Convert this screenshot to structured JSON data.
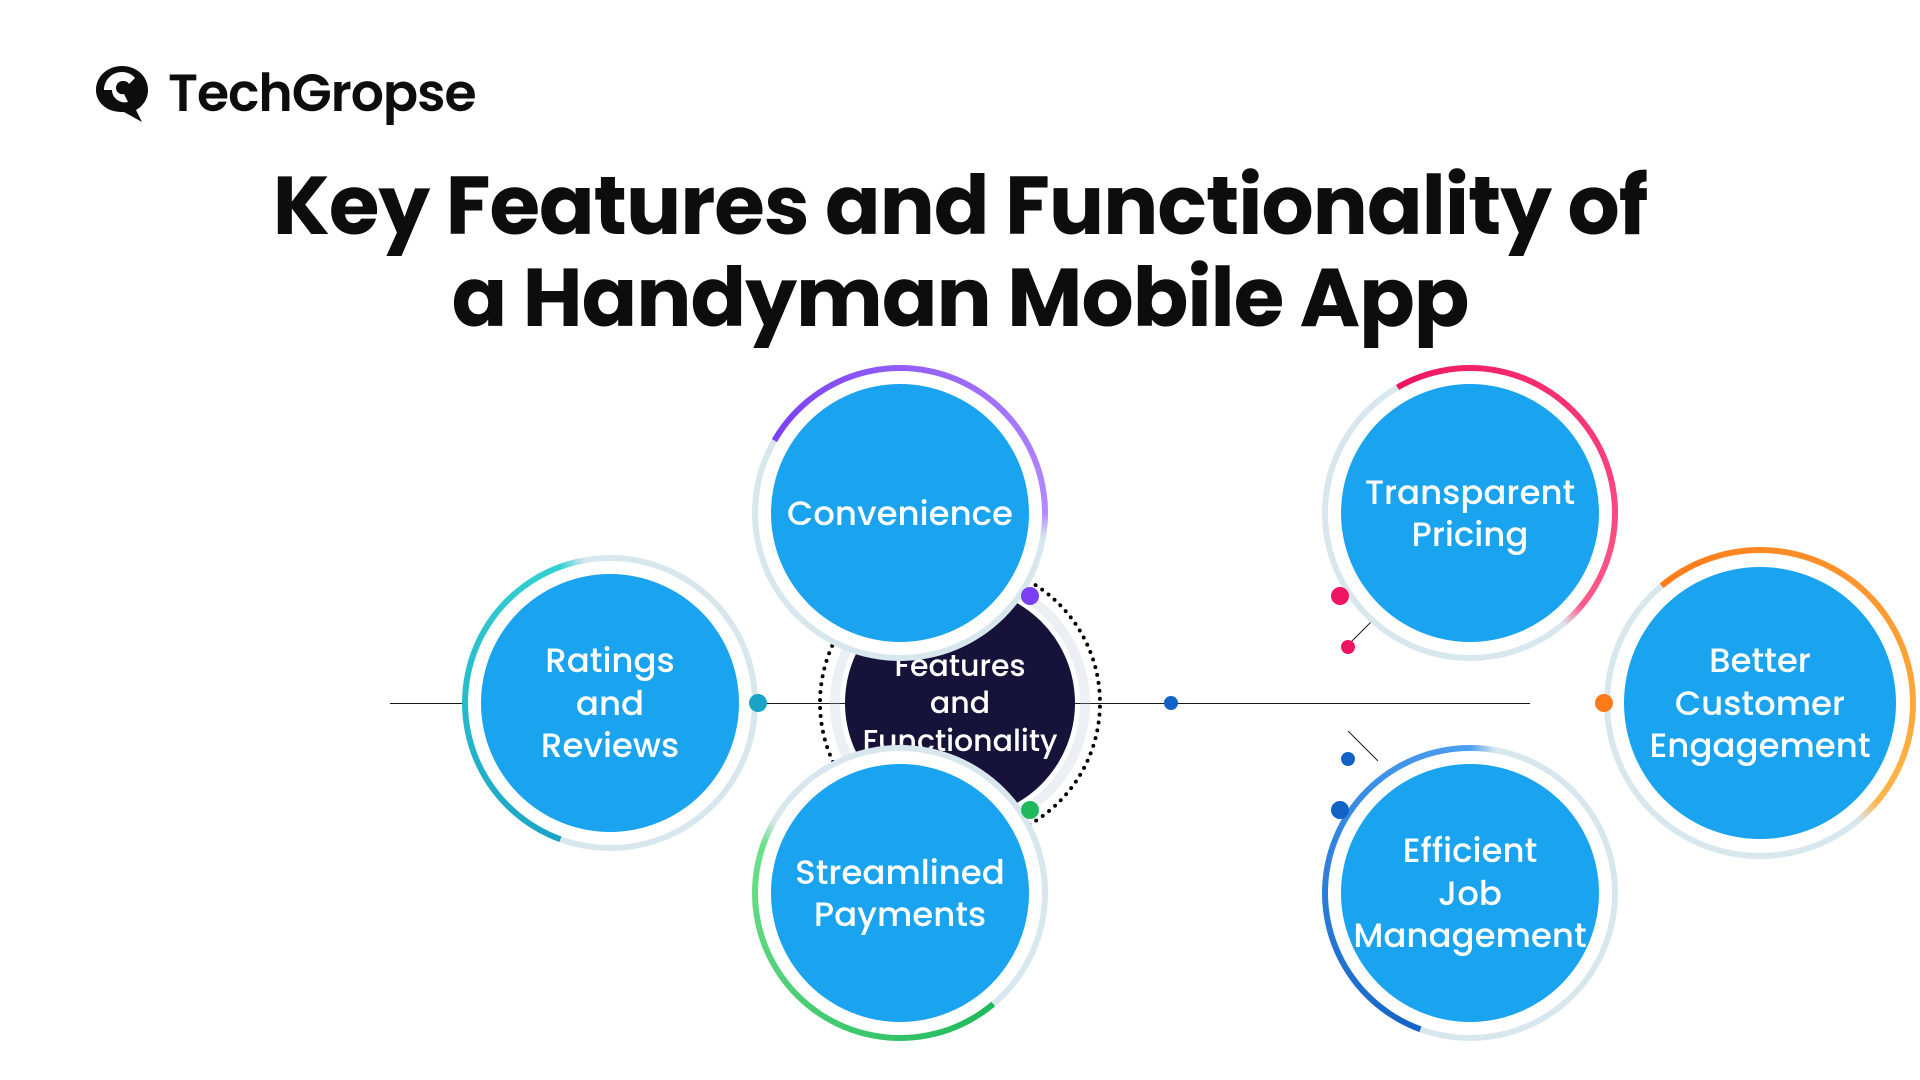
{
  "logo": {
    "brand_text": "TechGropse"
  },
  "title": "Key Features and Functionality of\na Handyman Mobile App",
  "center": {
    "label": "Features\nand\nFunctionality"
  },
  "features": {
    "ratings": {
      "label": "Ratings\nand\nReviews"
    },
    "convenience": {
      "label": "Convenience"
    },
    "payments": {
      "label": "Streamlined\nPayments"
    },
    "pricing": {
      "label": "Transparent\nPricing"
    },
    "jobs": {
      "label": "Efficient\nJob\nManagement"
    },
    "engagement": {
      "label": "Better\nCustomer\nEngagement"
    }
  },
  "colors": {
    "node_fill": "#1aa3ef",
    "center_fill": "#17123a",
    "ratings_ring": "#1aa3c4",
    "convenience_ring": "#7a3ff2",
    "payments_ring": "#1fb85b",
    "pricing_ring": "#ef1460",
    "jobs_ring": "#1363c6",
    "engagement_ring": "#ff7a18"
  }
}
